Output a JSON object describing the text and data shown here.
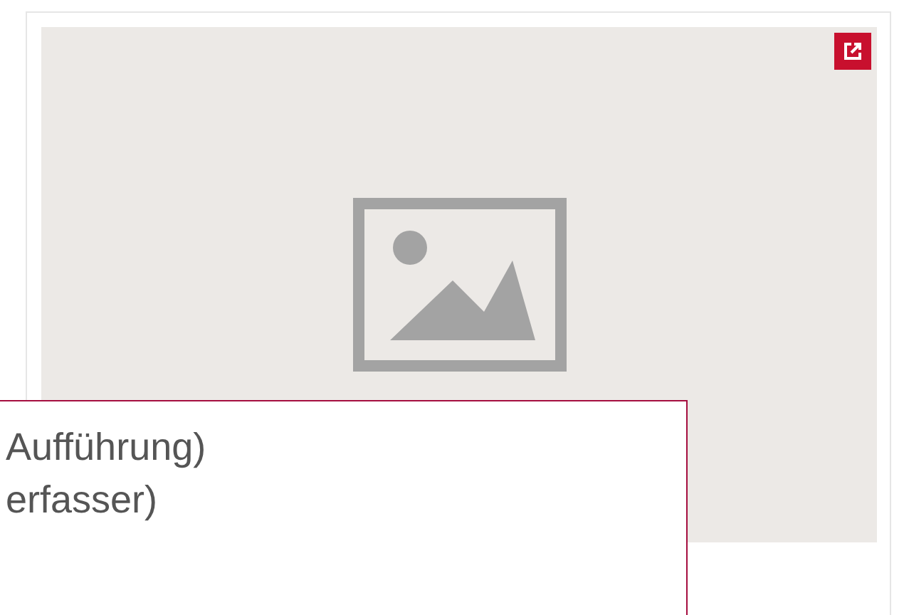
{
  "popup": {
    "lines": [
      "Aufführung)",
      "erfasser)"
    ]
  }
}
